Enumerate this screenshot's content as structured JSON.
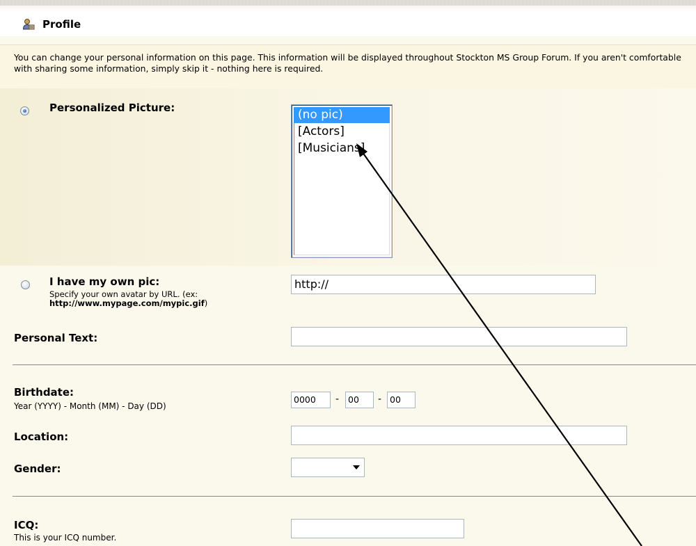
{
  "header": {
    "title": "Profile",
    "icon": "user-profile-icon"
  },
  "intro": {
    "text": "You can change your personal information on this page. This information will be displayed throughout Stockton MS Group Forum. If you aren't comfortable with sharing some information, simply skip it - nothing here is required."
  },
  "avatar": {
    "personalized_label": "Personalized Picture:",
    "personalized_selected": true,
    "options": [
      "(no pic)",
      "[Actors]",
      "[Musicians]"
    ],
    "selected_option": "(no pic)",
    "own_pic_label": "I have my own pic:",
    "own_pic_hint_prefix": "Specify your own avatar by URL. (ex:",
    "own_pic_hint_example": "http://www.mypage.com/mypic.gif",
    "own_pic_hint_suffix": ")",
    "own_pic_selected": false,
    "url_value": "http://"
  },
  "personal_text": {
    "label": "Personal Text:",
    "value": ""
  },
  "birthdate": {
    "label": "Birthdate:",
    "hint": "Year (YYYY) - Month (MM) - Day (DD)",
    "year": "0000",
    "month": "00",
    "day": "00",
    "separator": "-"
  },
  "location": {
    "label": "Location:",
    "value": ""
  },
  "gender": {
    "label": "Gender:",
    "value": ""
  },
  "icq": {
    "label": "ICQ:",
    "hint": "This is your ICQ number.",
    "value": ""
  },
  "colors": {
    "selection": "#3399ff",
    "background": "#fbf8ec",
    "annotation_arrow": "#000000"
  }
}
